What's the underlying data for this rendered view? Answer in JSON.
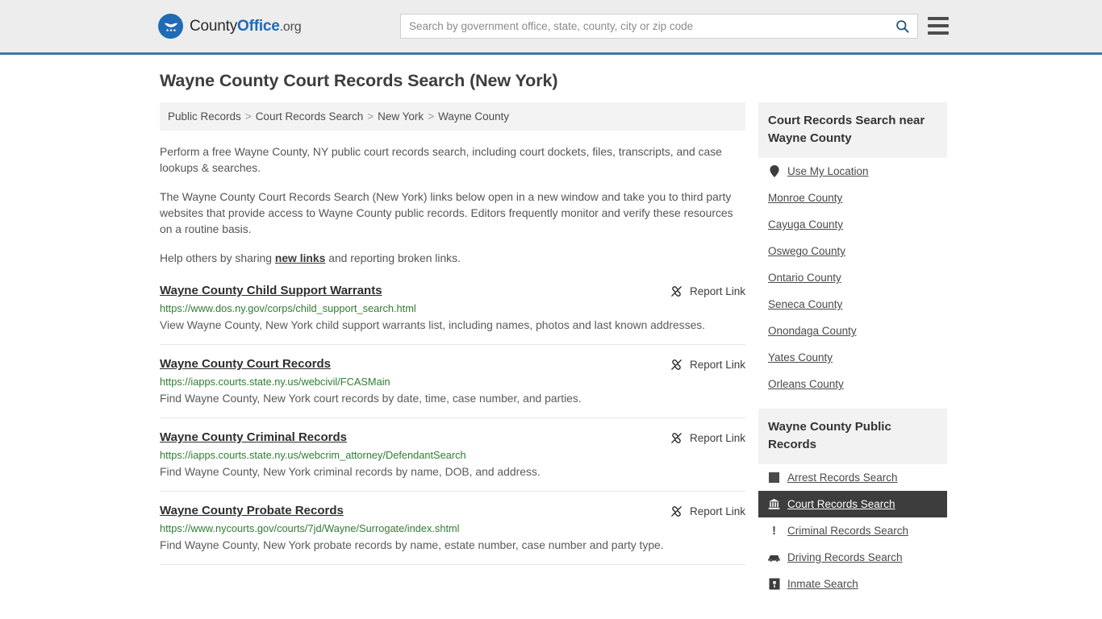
{
  "header": {
    "brand": {
      "part1": "County",
      "part2": "Office",
      "part3": ".org",
      "logo_icon": "eagle-shield-logo"
    },
    "search": {
      "placeholder": "Search by government office, state, county, city or zip code",
      "value": "",
      "search_icon": "search-icon"
    },
    "menu_icon": "hamburger-menu-icon"
  },
  "page": {
    "title": "Wayne County Court Records Search (New York)"
  },
  "breadcrumb": {
    "items": [
      {
        "label": "Public Records"
      },
      {
        "label": "Court Records Search"
      },
      {
        "label": "New York"
      },
      {
        "label": "Wayne County"
      }
    ],
    "separator": ">"
  },
  "intro": {
    "p1": "Perform a free Wayne County, NY public court records search, including court dockets, files, transcripts, and case lookups & searches.",
    "p2": "The Wayne County Court Records Search (New York) links below open in a new window and take you to third party websites that provide access to Wayne County public records. Editors frequently monitor and verify these resources on a routine basis.",
    "p3_before": "Help others by sharing ",
    "p3_link": "new links",
    "p3_after": " and reporting broken links."
  },
  "results": {
    "report_label": "Report Link",
    "report_icon": "broken-link-icon",
    "items": [
      {
        "title": "Wayne County Child Support Warrants",
        "url": "https://www.dos.ny.gov/corps/child_support_search.html",
        "description": "View Wayne County, New York child support warrants list, including names, photos and last known addresses."
      },
      {
        "title": "Wayne County Court Records",
        "url": "https://iapps.courts.state.ny.us/webcivil/FCASMain",
        "description": "Find Wayne County, New York court records by date, time, case number, and parties."
      },
      {
        "title": "Wayne County Criminal Records",
        "url": "https://iapps.courts.state.ny.us/webcrim_attorney/DefendantSearch",
        "description": "Find Wayne County, New York criminal records by name, DOB, and address."
      },
      {
        "title": "Wayne County Probate Records",
        "url": "https://www.nycourts.gov/courts/7jd/Wayne/Surrogate/index.shtml",
        "description": "Find Wayne County, New York probate records by name, estate number, case number and party type."
      }
    ]
  },
  "sidebar": {
    "nearby": {
      "heading": "Court Records Search near Wayne County",
      "items": [
        {
          "label": "Use My Location",
          "icon": "map-pin-icon"
        },
        {
          "label": "Monroe County",
          "icon": ""
        },
        {
          "label": "Cayuga County",
          "icon": ""
        },
        {
          "label": "Oswego County",
          "icon": ""
        },
        {
          "label": "Ontario County",
          "icon": ""
        },
        {
          "label": "Seneca County",
          "icon": ""
        },
        {
          "label": "Onondaga County",
          "icon": ""
        },
        {
          "label": "Yates County",
          "icon": ""
        },
        {
          "label": "Orleans County",
          "icon": ""
        }
      ]
    },
    "public_records": {
      "heading": "Wayne County Public Records",
      "items": [
        {
          "label": "Arrest Records Search",
          "icon": "fingerprint-square-icon",
          "active": false
        },
        {
          "label": "Court Records Search",
          "icon": "courthouse-icon",
          "active": true
        },
        {
          "label": "Criminal Records Search",
          "icon": "exclamation-icon",
          "active": false
        },
        {
          "label": "Driving Records Search",
          "icon": "car-icon",
          "active": false
        },
        {
          "label": "Inmate Search",
          "icon": "jail-icon",
          "active": false
        }
      ]
    }
  },
  "colors": {
    "brand_blue": "#1f6bb5",
    "header_border": "#3a76a8",
    "url_green": "#2f7d32",
    "active_bg": "#3d3d3d",
    "panel_bg": "#f2f2f2"
  }
}
